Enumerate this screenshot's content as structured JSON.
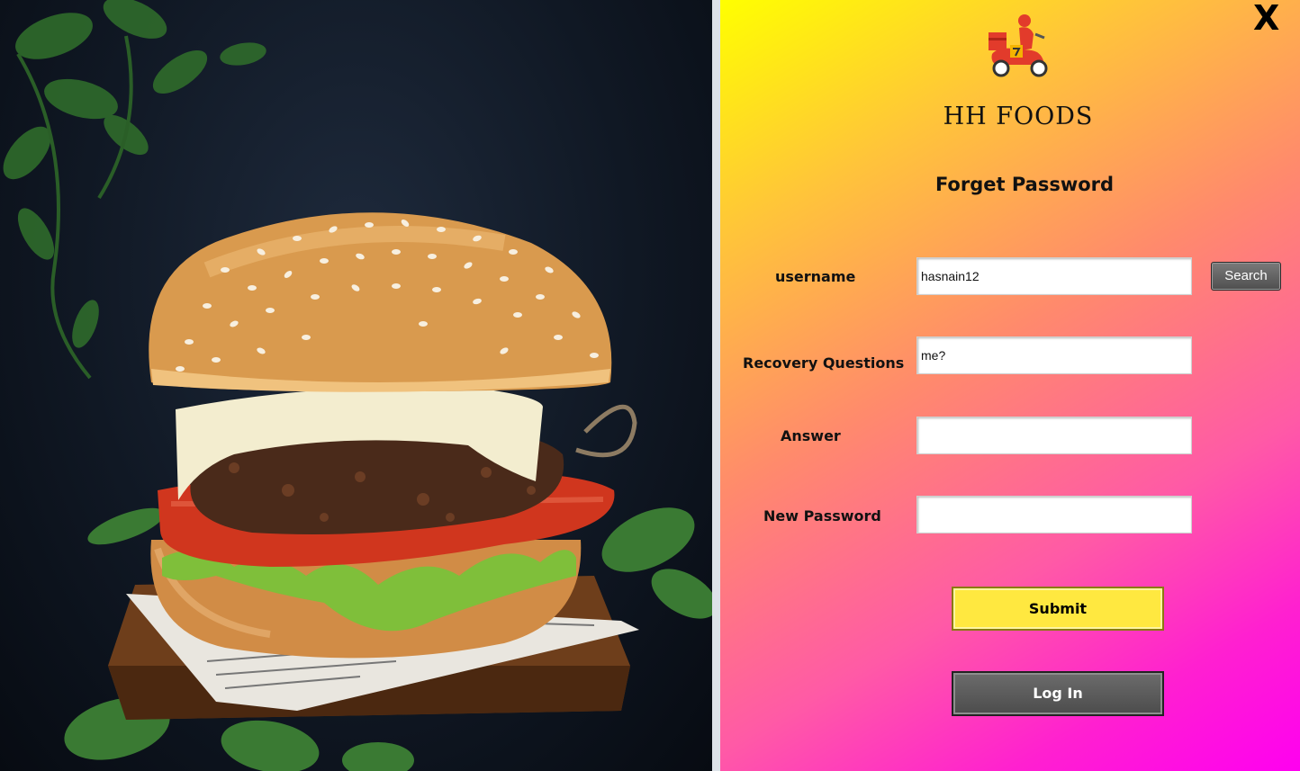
{
  "brand": {
    "name": "HH FOODS",
    "logo_icon": "delivery-scooter-icon"
  },
  "form": {
    "title": "Forget Password",
    "username_label": "username",
    "username_value": "hasnain12",
    "search_label": "Search",
    "recovery_label": "Recovery Questions",
    "recovery_value": "me?",
    "answer_label": "Answer",
    "answer_value": "",
    "new_password_label": "New Password",
    "new_password_value": "",
    "submit_label": "Submit",
    "login_label": "Log In"
  },
  "window": {
    "close_label": "X"
  },
  "colors": {
    "gradient_top": "#ffff00",
    "gradient_bottom": "#ff00f0",
    "submit_bg": "#ffe840",
    "login_bg": "#5a5a5a"
  }
}
